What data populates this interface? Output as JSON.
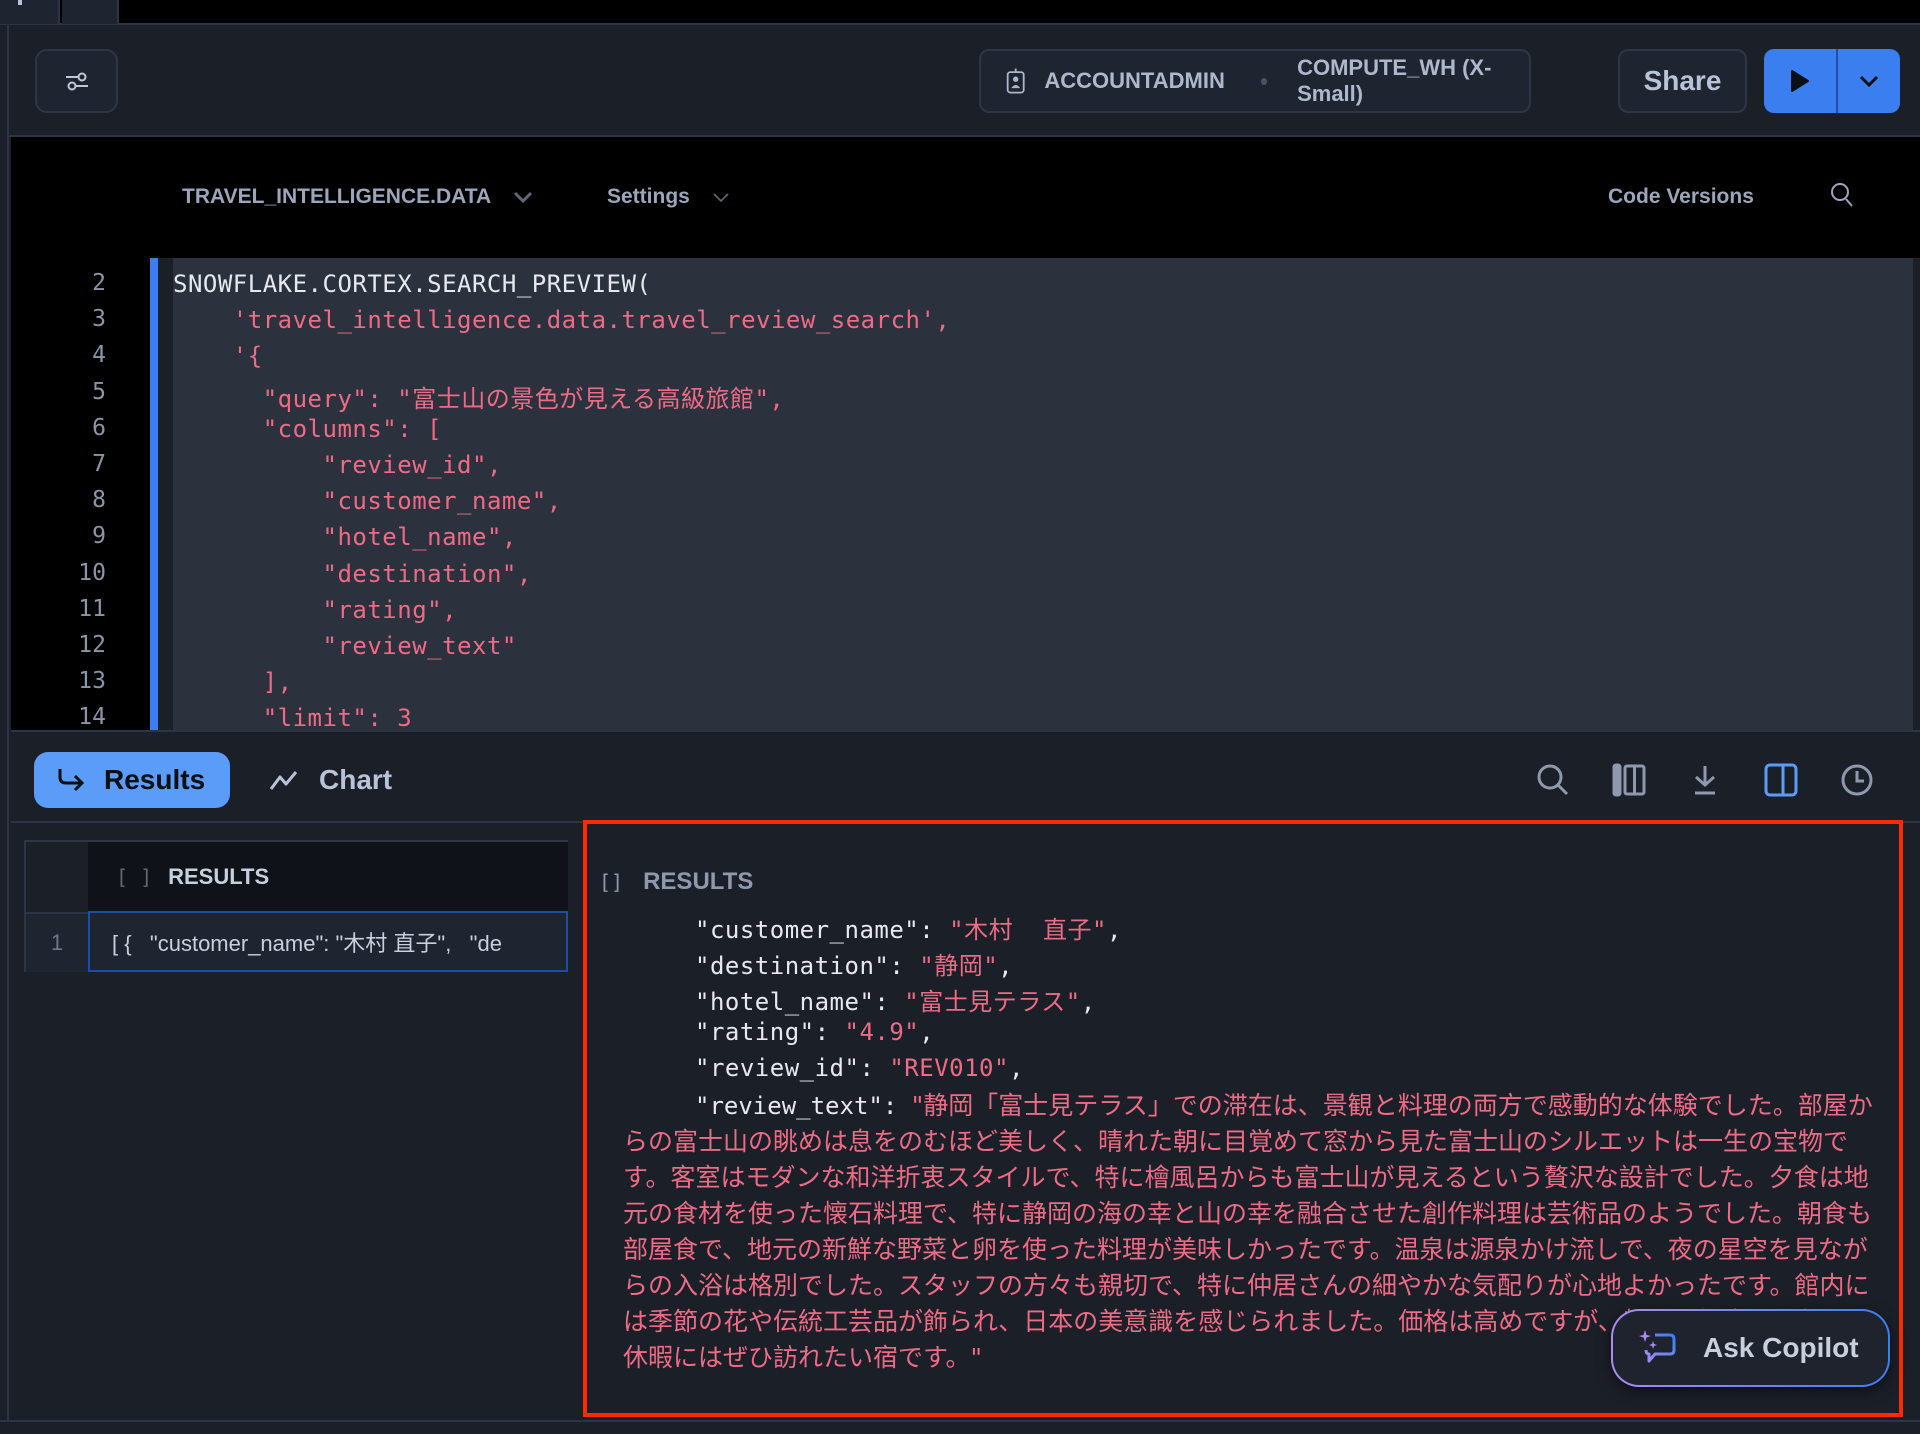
{
  "toolbar": {
    "filter_icon": "sliders-icon",
    "role": "ACCOUNTADMIN",
    "warehouse": "COMPUTE_WH (X-Small)",
    "share_label": "Share",
    "run_icon": "play-icon",
    "run_menu_icon": "chevron-down-icon",
    "accent": "#3a7ef0"
  },
  "editor_header": {
    "database_schema": "TRAVEL_INTELLIGENCE.DATA",
    "settings_label": "Settings",
    "code_versions_label": "Code Versions"
  },
  "code": {
    "line_numbers": [
      "2",
      "3",
      "4",
      "5",
      "6",
      "7",
      "8",
      "9",
      "10",
      "11",
      "12",
      "13",
      "14"
    ],
    "lines": [
      {
        "indent": "",
        "text": "SNOWFLAKE.CORTEX.SEARCH_PREVIEW(",
        "kind": "plain"
      },
      {
        "indent": "    ",
        "text": "'travel_intelligence.data.travel_review_search',",
        "kind": "str"
      },
      {
        "indent": "    ",
        "text": "'{",
        "kind": "str"
      },
      {
        "indent": "      ",
        "text": "\"query\": \"富士山の景色が見える高級旅館\",",
        "kind": "str"
      },
      {
        "indent": "      ",
        "text": "\"columns\": [",
        "kind": "str"
      },
      {
        "indent": "          ",
        "text": "\"review_id\",",
        "kind": "str"
      },
      {
        "indent": "          ",
        "text": "\"customer_name\",",
        "kind": "str"
      },
      {
        "indent": "          ",
        "text": "\"hotel_name\",",
        "kind": "str"
      },
      {
        "indent": "          ",
        "text": "\"destination\",",
        "kind": "str"
      },
      {
        "indent": "          ",
        "text": "\"rating\",",
        "kind": "str"
      },
      {
        "indent": "          ",
        "text": "\"review_text\"",
        "kind": "str"
      },
      {
        "indent": "      ",
        "text": "],",
        "kind": "str"
      },
      {
        "indent": "      ",
        "text": "\"limit\": 3",
        "kind": "str"
      }
    ]
  },
  "results_tabs": {
    "results_label": "Results",
    "chart_label": "Chart",
    "icons": [
      "search-icon",
      "columns-icon",
      "download-icon",
      "split-panel-icon",
      "history-icon"
    ]
  },
  "grid": {
    "column_header": "RESULTS",
    "column_type_glyph": "[ ]",
    "rows": [
      {
        "row_number": "1",
        "value": "[ {   \"customer_name\": \"木村 直子\",   \"de"
      }
    ]
  },
  "detail": {
    "header": "RESULTS",
    "type_glyph": "[]",
    "fields": [
      {
        "key": "\"customer_name\": ",
        "value": "\"木村  直子\"",
        "sep": ","
      },
      {
        "key": "\"destination\": ",
        "value": "\"静岡\"",
        "sep": ","
      },
      {
        "key": "\"hotel_name\": ",
        "value": "\"富士見テラス\"",
        "sep": ","
      },
      {
        "key": "\"rating\": ",
        "value": "\"4.9\"",
        "sep": ","
      },
      {
        "key": "\"review_id\": ",
        "value": "\"REV010\"",
        "sep": ","
      }
    ],
    "review_text_key": "\"review_text\": ",
    "review_text_value": "\"静岡「富士見テラス」での滞在は、景観と料理の両方で感動的な体験でした。部屋からの富士山の眺めは息をのむほど美しく、晴れた朝に目覚めて窓から見た富士山のシルエットは一生の宝物です。客室はモダンな和洋折衷スタイルで、特に檜風呂からも富士山が見えるという贅沢な設計でした。夕食は地元の食材を使った懐石料理で、特に静岡の海の幸と山の幸を融合させた創作料理は芸術品のようでした。朝食も部屋食で、地元の新鮮な野菜と卵を使った料理が美味しかったです。温泉は源泉かけ流しで、夜の星空を見ながらの入浴は格別でした。スタッフの方々も親切で、特に仲居さんの細やかな気配りが心地よかったです。館内には季節の花や伝統工芸品が飾られ、日本の美意識を感じられました。価格は高めですが、特別な記念日や贅沢な休暇にはぜひ訪れたい宿です。\"",
    "highlight_color": "#ff2a00",
    "string_color": "#ee6b86"
  },
  "copilot": {
    "label": "Ask Copilot",
    "icon": "sparkle-chat-icon"
  }
}
